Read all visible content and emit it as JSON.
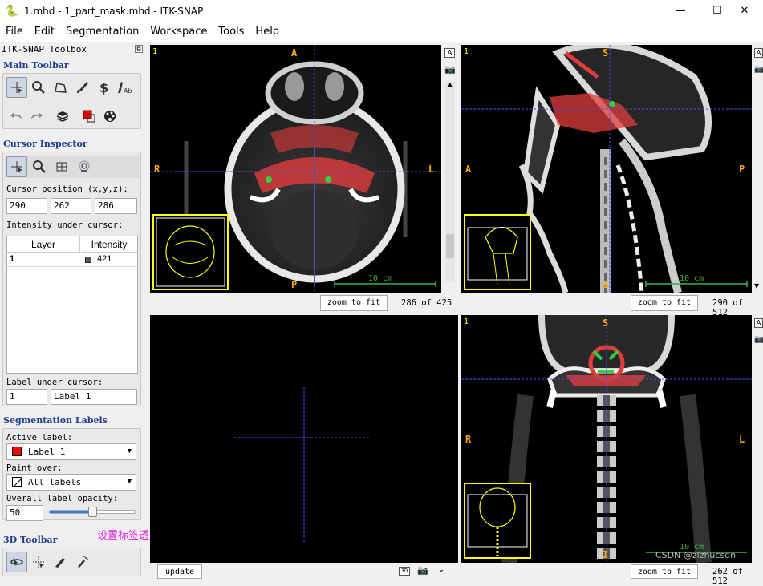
{
  "window": {
    "title": "1.mhd - 1_part_mask.mhd - ITK-SNAP",
    "minimize": "—",
    "maximize": "☐",
    "close": "✕"
  },
  "menu": [
    "File",
    "Edit",
    "Segmentation",
    "Workspace",
    "Tools",
    "Help"
  ],
  "toolbox": {
    "title": "ITK-SNAP Toolbox",
    "main_toolbar_title": "Main Toolbar",
    "cursor_inspector_title": "Cursor Inspector",
    "cursor_position_label": "Cursor position (x,y,z):",
    "cursor_x": "290",
    "cursor_y": "262",
    "cursor_z": "286",
    "intensity_label": "Intensity under cursor:",
    "table_headers": [
      "Layer",
      "Intensity"
    ],
    "table_rows": [
      {
        "layer": "1",
        "intensity": "421"
      }
    ],
    "label_under_cursor_label": "Label under cursor:",
    "label_under_cursor_id": "1",
    "label_under_cursor_name": "Label 1",
    "seg_labels_title": "Segmentation Labels",
    "active_label_label": "Active label:",
    "active_label_value": "Label 1",
    "active_label_color": "#ff0000",
    "paint_over_label": "Paint over:",
    "paint_over_value": "All labels",
    "opacity_label": "Overall label opacity:",
    "opacity_value": "50",
    "opacity_fraction": 0.5,
    "toolbar3d_title": "3D Toolbar"
  },
  "annotation": "设置标签透明度",
  "views": {
    "axial": {
      "num": "1",
      "top": "A",
      "bottom": "P",
      "left": "R",
      "right": "L",
      "scale": "10 cm",
      "zoom_button": "zoom to fit",
      "slice": "286 of 425"
    },
    "sagittal": {
      "num": "1",
      "top": "S",
      "bottom": "I",
      "left": "A",
      "right": "P",
      "scale": "10 cm",
      "zoom_button": "zoom to fit",
      "slice": "290 of 512"
    },
    "threed": {
      "update_button": "update"
    },
    "coronal": {
      "num": "1",
      "top": "S",
      "bottom": "I",
      "left": "R",
      "right": "L",
      "scale": "10 cm",
      "zoom_button": "zoom to fit",
      "slice": "262 of 512",
      "watermark": "CSDN @zlzhucsdn"
    }
  },
  "colors": {
    "accent_label": "#ff0000",
    "crosshair": "#4d4dff",
    "orientation": "#ffa500",
    "thumbnail": "#ffff00",
    "scale_bar": "#3cb043",
    "section_title": "#1f3f8f"
  }
}
